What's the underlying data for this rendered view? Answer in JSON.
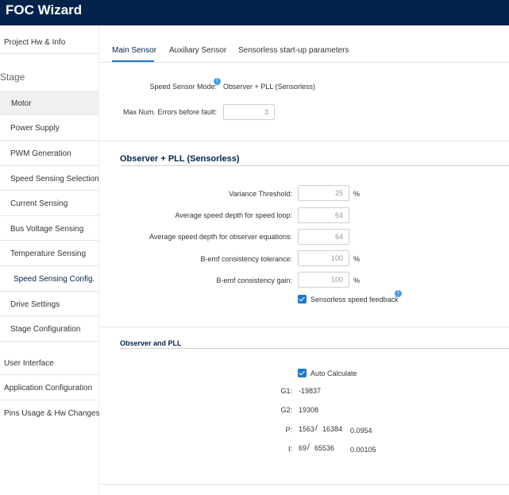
{
  "app": {
    "title": "FOC Wizard"
  },
  "sidebar": {
    "top_item": "Project Hw & Info",
    "stage_header": "Stage",
    "stage_items": [
      "Motor",
      "Power Supply",
      "PWM Generation",
      "Speed Sensing Selection",
      "Current Sensing",
      "Bus Voltage Sensing",
      "Temperature Sensing",
      "Speed Sensing Config.",
      "Drive Settings",
      "Stage Configuration"
    ],
    "bottom_items": [
      "User Interface",
      "Application Configuration",
      "Pins Usage & Hw Changes"
    ]
  },
  "tabs": {
    "main_sensor": "Main Sensor",
    "auxiliary_sensor": "Auxiliary Sensor",
    "sensorless_startup": "Sensorless start-up parameters"
  },
  "general": {
    "speed_sensor_mode_label": "Speed Sensor Mode:",
    "speed_sensor_mode_value": "Observer + PLL (Sensorless)",
    "info_marker": "!",
    "max_errors_label": "Max Num. Errors before fault:",
    "max_errors_value": "3"
  },
  "observer_section": {
    "title": "Observer + PLL (Sensorless)",
    "fields": {
      "variance_threshold": {
        "label": "Variance Threshold:",
        "value": "25",
        "unit": "%"
      },
      "avg_speed_depth_loop": {
        "label": "Average speed depth for speed loop:",
        "value": "64"
      },
      "avg_speed_depth_observer": {
        "label": "Average speed depth for observer equations:",
        "value": "64"
      },
      "bemf_tolerance": {
        "label": "B-emf consistency tolerance:",
        "value": "100",
        "unit": "%"
      },
      "bemf_gain": {
        "label": "B-emf consistency gain:",
        "value": "100",
        "unit": "%"
      }
    },
    "sensorless_feedback_label": "Sensorless speed feedback"
  },
  "pll_section": {
    "title": "Observer and PLL",
    "auto_calculate_label": "Auto Calculate",
    "g1": {
      "label": "G1:",
      "value": "-19837"
    },
    "g2": {
      "label": "G2:",
      "value": "19308"
    },
    "p": {
      "label": "P:",
      "num": "1563",
      "sep": "/",
      "den": "16384",
      "result": "0.0954"
    },
    "i": {
      "label": "I:",
      "num": "69",
      "sep": "/",
      "den": "65536",
      "result": "0.00105"
    }
  },
  "colors": {
    "header_bg": "#03234b",
    "accent": "#1f77c9",
    "info_dot": "#4a9be8"
  }
}
